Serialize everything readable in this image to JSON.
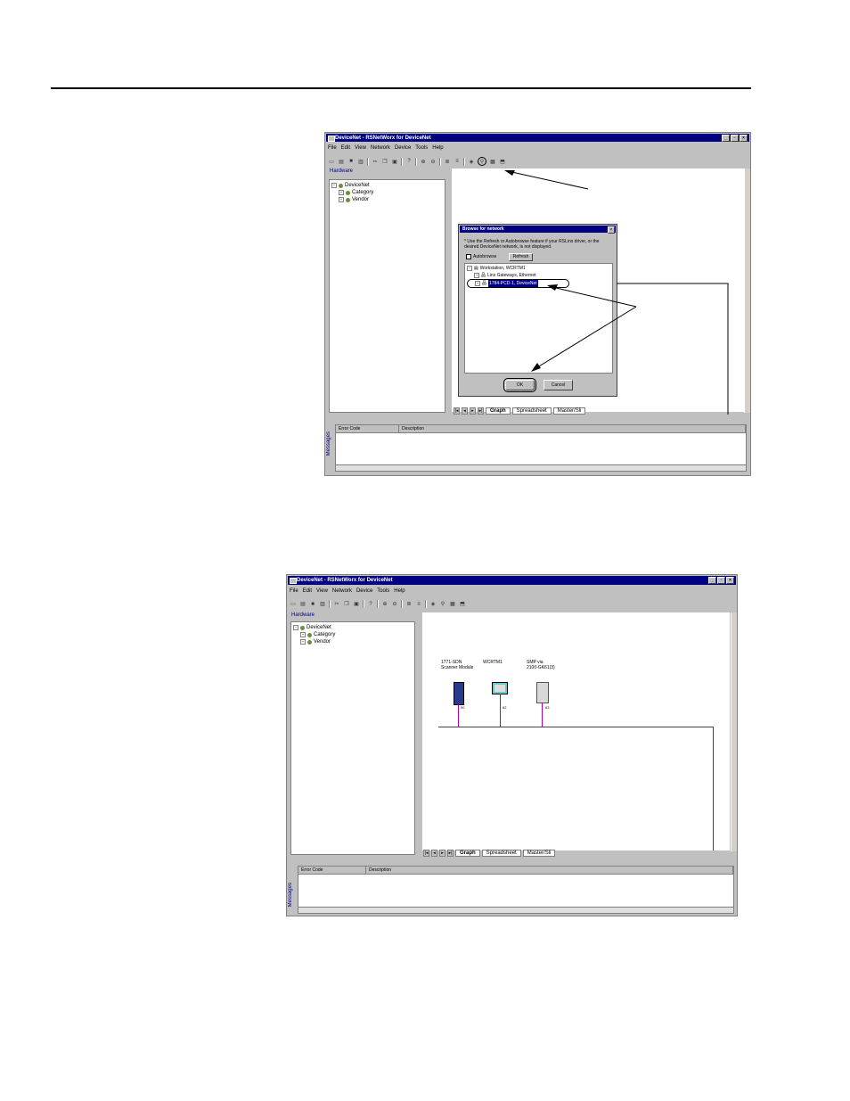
{
  "top_window": {
    "title": "DeviceNet - RSNetWorx for DeviceNet",
    "menu": [
      "File",
      "Edit",
      "View",
      "Network",
      "Device",
      "Tools",
      "Help"
    ],
    "hardware_label": "Hardware",
    "tree": [
      "DeviceNet",
      "Category",
      "Vendor"
    ],
    "tabs": [
      "Graph",
      "Spreadsheet",
      "Master/Sli"
    ],
    "messages_label": "Messages",
    "msg_columns": [
      "Error Code",
      "Description"
    ],
    "dialog": {
      "title": "Browse for network",
      "instruction": "* Use the Refresh or Autobrowse feature if your RSLinx driver, or the desired DeviceNet network, is not displayed.",
      "autobrowse_label": "Autobrowse",
      "refresh_label": "Refresh",
      "tree": [
        "Workstation, WCRTM1",
        "Linx Gateways, Ethernet",
        "1784-PCD-1, DeviceNet"
      ],
      "ok_label": "OK",
      "cancel_label": "Cancel"
    }
  },
  "bottom_window": {
    "title": "DeviceNet - RSNetWorx for DeviceNet",
    "menu": [
      "File",
      "Edit",
      "View",
      "Network",
      "Device",
      "Tools",
      "Help"
    ],
    "hardware_label": "Hardware",
    "tree": [
      "DeviceNet",
      "Category",
      "Vendor"
    ],
    "tabs": [
      "Graph",
      "Spreadsheet",
      "Master/Sli"
    ],
    "messages_label": "Messages",
    "msg_columns": [
      "Error Code",
      "Description"
    ],
    "devices": [
      {
        "label_line1": "1771-SDN",
        "label_line2": "Scanner Module",
        "address": "00"
      },
      {
        "label_line1": "WCRTM1",
        "label_line2": "",
        "address": "62"
      },
      {
        "label_line1": "SMP via",
        "label_line2": "2100-GK61(3)",
        "address": "63"
      }
    ]
  }
}
